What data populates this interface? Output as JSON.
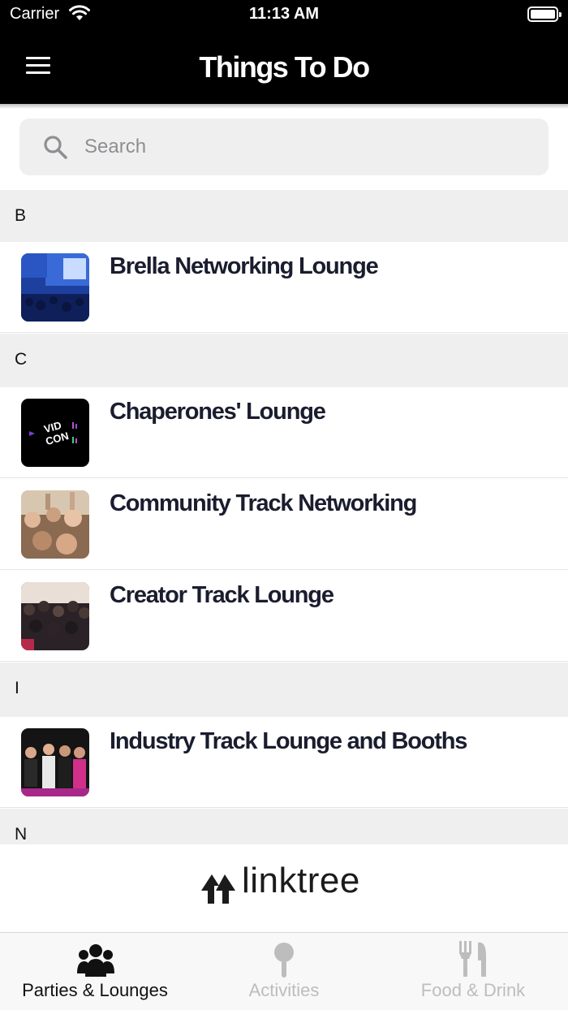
{
  "status": {
    "carrier": "Carrier",
    "time": "11:13 AM"
  },
  "header": {
    "title": "Things To Do",
    "background": "#000000"
  },
  "search": {
    "placeholder": "Search"
  },
  "sections": [
    {
      "letter": "B",
      "items": [
        "Brella Networking Lounge"
      ]
    },
    {
      "letter": "C",
      "items": [
        "Chaperones' Lounge",
        "Community Track Networking",
        "Creator Track Lounge"
      ]
    },
    {
      "letter": "I",
      "items": [
        "Industry Track Lounge and Booths"
      ]
    },
    {
      "letter": "N",
      "items": []
    }
  ],
  "vidcon_logo": {
    "line1": "VID",
    "line2": "CON"
  },
  "banner": {
    "text": "linktree"
  },
  "tabs": [
    {
      "label": "Parties & Lounges",
      "icon": "group-icon",
      "active": true
    },
    {
      "label": "Activities",
      "icon": "pin-icon",
      "active": false
    },
    {
      "label": "Food & Drink",
      "icon": "fork-knife-icon",
      "active": false
    }
  ],
  "colors": {
    "tab_active": "#111111",
    "tab_inactive": "#bdbdbd",
    "section_bg": "#efefef",
    "title_text": "#1a1d2e"
  }
}
